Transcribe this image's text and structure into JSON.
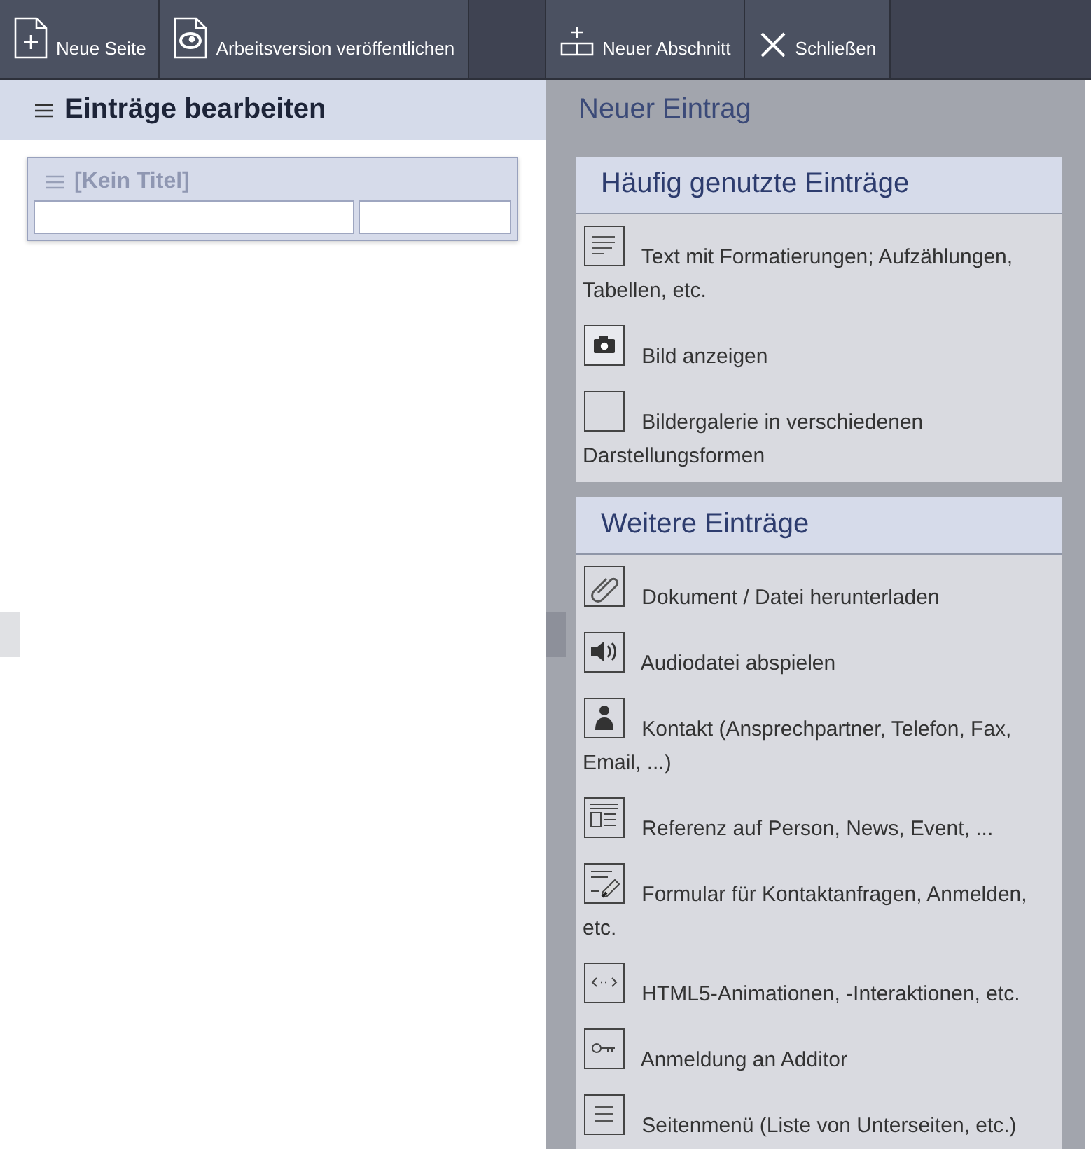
{
  "toolbar": {
    "left": [
      {
        "label": "Neue Seite",
        "kind": "new-page"
      },
      {
        "label": "Arbeitsversion veröffentlichen",
        "kind": "publish"
      }
    ],
    "right": [
      {
        "label": "Neuer Abschnitt",
        "kind": "new-section"
      },
      {
        "label": "Schließen",
        "kind": "close"
      }
    ]
  },
  "editor": {
    "title": "Einträge bearbeiten",
    "section": {
      "title": "[Kein Titel]"
    }
  },
  "panel": {
    "title": "Neuer Eintrag",
    "groups": [
      {
        "title": "Häufig genutzte Einträge",
        "items": [
          {
            "label": "Text mit Formatierungen; Aufzählungen, Tabellen, etc.",
            "kind": "text"
          },
          {
            "label": "Bild anzeigen",
            "kind": "image"
          },
          {
            "label": "Bildergalerie in verschiedenen Darstellungsformen",
            "kind": "gallery"
          }
        ]
      },
      {
        "title": "Weitere Einträge",
        "items": [
          {
            "label": "Dokument / Datei herunterladen",
            "kind": "download"
          },
          {
            "label": "Audiodatei abspielen",
            "kind": "audio"
          },
          {
            "label": "Kontakt (Ansprechpartner, Telefon, Fax, Email, ...)",
            "kind": "contact"
          },
          {
            "label": "Referenz auf Person, News, Event, ...",
            "kind": "reference"
          },
          {
            "label": "Formular für Kontaktanfragen, Anmelden, etc.",
            "kind": "form"
          },
          {
            "label": "HTML5-Animationen, -Interaktionen, etc.",
            "kind": "html5"
          },
          {
            "label": "Anmeldung an Additor",
            "kind": "login"
          },
          {
            "label": "Seitenmenü (Liste von Unterseiten, etc.)",
            "kind": "menu"
          }
        ]
      }
    ]
  }
}
